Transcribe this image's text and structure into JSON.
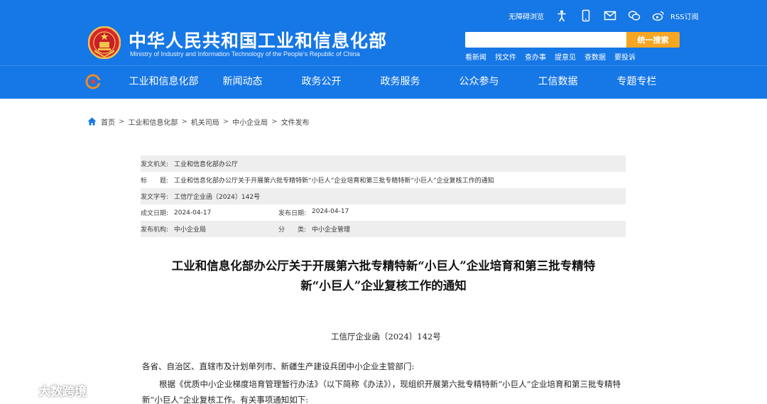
{
  "header": {
    "site_name": "中华人民共和国工业和信息化部",
    "site_name_en": "Ministry of Industry and Information Technology of the People's Republic of China",
    "accessibility": "无障碍浏览",
    "rss": "RSS订阅",
    "icons": [
      "accessibility-person-icon",
      "mobile-icon",
      "mail-icon",
      "wechat-icon",
      "weibo-icon"
    ],
    "search": {
      "placeholder": "",
      "button": "统一搜索"
    },
    "quick_links": [
      "看新闻",
      "找文件",
      "查办事",
      "提意见",
      "查数据",
      "要投诉"
    ]
  },
  "nav": {
    "items": [
      "工业和信息化部",
      "新闻动态",
      "政务公开",
      "政务服务",
      "公众参与",
      "工信数据",
      "专题专栏"
    ]
  },
  "breadcrumb": [
    "首页",
    "工业和信息化部",
    "机关司局",
    "中小企业局",
    "文件发布"
  ],
  "meta": {
    "issuer_label": "发文机关:",
    "issuer": "工业和信息化部办公厅",
    "title_label": "标　　题:",
    "title": "工业和信息化部办公厅关于开展第六批专精特新“小巨人”企业培育和第三批专精特新“小巨人”企业复核工作的通知",
    "doc_no_label": "发文字号:",
    "doc_no": "工信厅企业函〔2024〕142号",
    "created_label": "成文日期:",
    "created": "2024-04-17",
    "published_label": "发布日期:",
    "published": "2024-04-17",
    "org_label": "发布机构:",
    "org": "中小企业局",
    "category_label": "分　　类:",
    "category": "中小企业管理"
  },
  "document": {
    "title_line1": "工业和信息化部办公厅关于开展第六批专精特新“小巨人”企业培育和第三批专精特",
    "title_line2": "新“小巨人”企业复核工作的通知",
    "number": "工信厅企业函〔2024〕142号",
    "addressee": "各省、自治区、直辖市及计划单列市、新疆生产建设兵团中小企业主管部门:",
    "paragraph": "根据《优质中小企业梯度培育管理暂行办法》（以下简称《办法》），现组织开展第六批专精特新“小巨人”企业培育和第三批专精特新“小巨人”企业复核工作。有关事项通知如下:"
  },
  "watermark": "大数跨境",
  "colors": {
    "header_blue": "#1677e6",
    "search_orange": "#f5a623",
    "meta_shade": "#eeeeee"
  }
}
